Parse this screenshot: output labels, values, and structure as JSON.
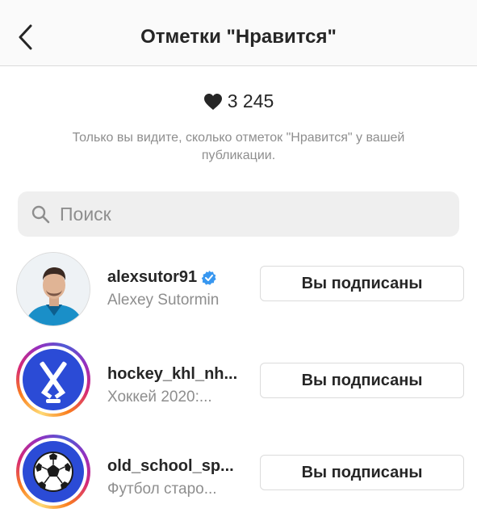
{
  "header": {
    "title": "Отметки \"Нравится\"",
    "back_icon": "chevron-left-icon"
  },
  "likes": {
    "count": "3 245",
    "icon": "heart-icon",
    "note": "Только вы видите, сколько отметок \"Нравится\" у вашей публикации."
  },
  "search": {
    "placeholder": "Поиск",
    "value": ""
  },
  "users": [
    {
      "username": "alexsutor91",
      "full_name": "Alexey Sutormin",
      "verified": true,
      "story_ring": false,
      "avatar": "person-photo",
      "button_label": "Вы подписаны"
    },
    {
      "username": "hockey_khl_nh...",
      "full_name": "Хоккей 2020:...",
      "verified": false,
      "story_ring": true,
      "avatar": "hockey-sticks-icon",
      "button_label": "Вы подписаны"
    },
    {
      "username": "old_school_sp...",
      "full_name": "Футбол старо...",
      "verified": false,
      "story_ring": true,
      "avatar": "soccer-ball-icon",
      "button_label": "Вы подписаны"
    }
  ],
  "colors": {
    "verified_badge": "#3897f0",
    "avatar_blue": "#2b4bd6",
    "text_primary": "#262626",
    "text_secondary": "#8e8e8e",
    "search_bg": "#efefef"
  }
}
